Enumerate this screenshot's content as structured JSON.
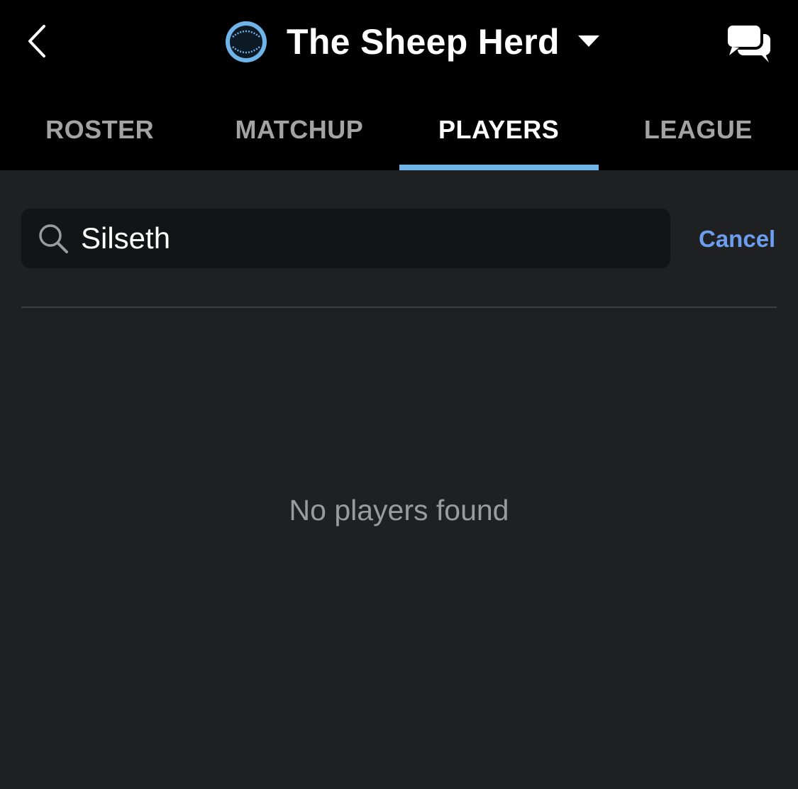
{
  "header": {
    "back_icon": "chevron-left-icon",
    "team_name": "The Sheep Herd",
    "logo_icon": "baseball-icon",
    "dropdown_icon": "caret-down-icon",
    "chat_icon": "chat-bubbles-icon"
  },
  "tabs": [
    {
      "label": "ROSTER",
      "active": false
    },
    {
      "label": "MATCHUP",
      "active": false
    },
    {
      "label": "PLAYERS",
      "active": true
    },
    {
      "label": "LEAGUE",
      "active": false
    }
  ],
  "search": {
    "value": "Silseth",
    "icon": "search-icon",
    "cancel_label": "Cancel"
  },
  "results": {
    "empty_message": "No players found"
  },
  "colors": {
    "accent_tab": "#6fb4e8",
    "cancel": "#6d9ded",
    "header_bg": "#000000",
    "body_bg": "#1f2022"
  }
}
